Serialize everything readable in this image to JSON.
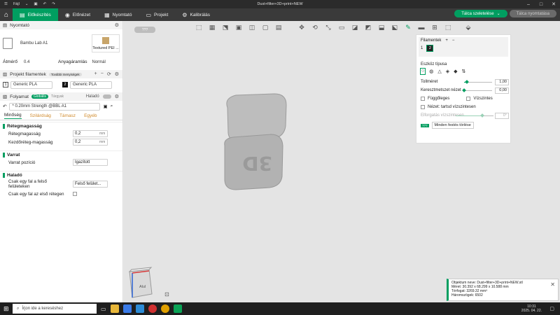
{
  "window": {
    "menu_label": "Fájl",
    "title": "Dust+filter+3D+print+NEW"
  },
  "nav": {
    "tabs": [
      {
        "label": "Előkészítés",
        "icon": "layers-icon"
      },
      {
        "label": "Előnézet",
        "icon": "eye-icon"
      },
      {
        "label": "Nyomtató",
        "icon": "printer-icon"
      },
      {
        "label": "Projekt",
        "icon": "folder-icon"
      },
      {
        "label": "Kalibrálás",
        "icon": "calibrate-icon"
      }
    ],
    "slice_button": "Tálca szeletelése",
    "print_button": "Tálca nyomtatása"
  },
  "left": {
    "printer_section": "Nyomtató",
    "printer_name": "Bambu Lab A1",
    "plate_name": "Textured PEI ...",
    "nozzle_label": "Átmérő",
    "nozzle_value": "0.4",
    "flow_label": "Anyagáramlás",
    "flow_value": "Normál",
    "project_filaments": "Projekt filamentek",
    "filament_chip": "További menyiségek",
    "fil1_num": "1",
    "fil1_name": "Generic PLA",
    "fil2_num": "2",
    "fil2_name": "Generic PLA",
    "process_label": "Folyamat",
    "global_badge": "Globális",
    "objects_badge": "Tárgyak",
    "advanced_label": "Haladó",
    "profile": "* 0.20mm Strength @BBL A1",
    "tabs": [
      "Minőség",
      "Szilárdság",
      "Támasz",
      "Egyéb"
    ],
    "groups": {
      "layer_height": "Rétegmagasság",
      "seam": "Varrat",
      "advanced": "Haladó"
    },
    "params": {
      "layer_h_label": "Rétegmagasság",
      "layer_h_value": "0,2",
      "layer_h_unit": "mm",
      "first_layer_label": "Kezdőréteg-magasság",
      "first_layer_value": "0,2",
      "first_layer_unit": "mm",
      "seam_pos_label": "Varrat pozíció",
      "seam_pos_value": "Igazított",
      "top_wall_label": "Csak egy fal a felső felületeken",
      "top_wall_value": "Felső felület...",
      "first_wall_label": "Csak egy fal az első rétegen"
    }
  },
  "popup": {
    "filaments_label": "Filamentek",
    "fil_num": "1",
    "fil_chip": "2",
    "tool_type_label": "Eszköz típusa",
    "tool_size_label": "Tollméret",
    "tool_size_value": "1,00",
    "section_label": "Keresztmetszet nézet",
    "section_value": "0,00",
    "vertical_label": "Függőleges",
    "horizontal_label": "Vízszintes",
    "hide_label": "Nézet: tartsd vízszintesen",
    "smart_label": "Elforgatás vízszintesen",
    "smart_value": "0°",
    "clear_button": "Minden festés törlése",
    "shortcut_badge": "???"
  },
  "notify": {
    "line1": "Objektum neve: Dust+filter+3D+print+NEW.stl",
    "line2": "Méret: 30.392 x 68.299 x 10.588 mm",
    "line3": "Térfogat: 3269.32 mm³",
    "line4": "Háromszögek: 6502"
  },
  "viewport": {
    "orient_label": "Alul",
    "undo_label": "???"
  },
  "taskbar": {
    "search": "Írjon ide a kereséshez",
    "time": "10:31",
    "date": "2025. 04. 22."
  }
}
